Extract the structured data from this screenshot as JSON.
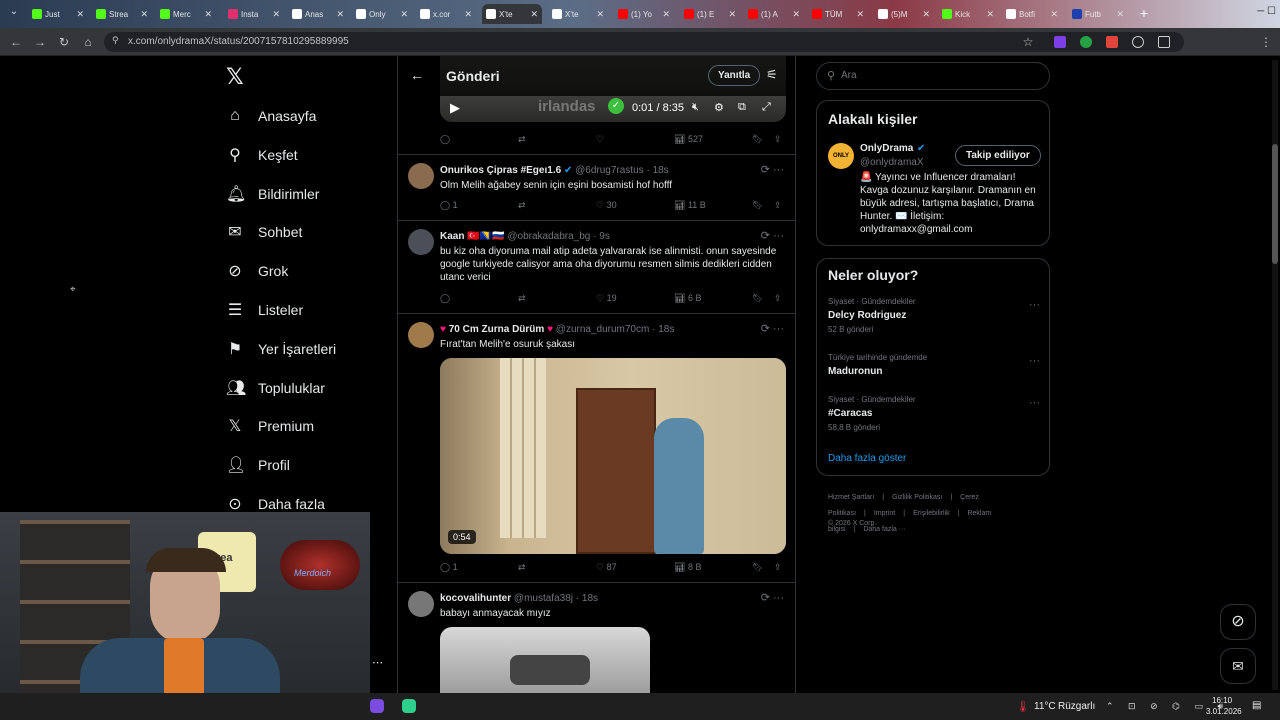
{
  "browser": {
    "tabs": [
      {
        "label": "Just",
        "icon": "kick-icon",
        "color": "#53fc18",
        "active": false
      },
      {
        "label": "Strea",
        "icon": "kick-icon",
        "color": "#53fc18",
        "active": false
      },
      {
        "label": "Merc",
        "icon": "kick-icon",
        "color": "#53fc18",
        "active": false
      },
      {
        "label": "Insta",
        "icon": "instagram-icon",
        "color": "#e1306c",
        "active": false
      },
      {
        "label": "Anas",
        "icon": "x-icon",
        "color": "#ffffff",
        "active": false
      },
      {
        "label": "Only",
        "icon": "x-icon",
        "color": "#ffffff",
        "active": false
      },
      {
        "label": "x.cor",
        "icon": "x-icon",
        "color": "#ffffff",
        "active": false
      },
      {
        "label": "X'te",
        "icon": "x-icon",
        "color": "#ffffff",
        "active": true
      },
      {
        "label": "X'te",
        "icon": "x-icon",
        "color": "#ffffff",
        "active": false
      },
      {
        "label": "(1) Yo",
        "icon": "youtube-icon",
        "color": "#ff0000",
        "active": false
      },
      {
        "label": "(1) E",
        "icon": "youtube-icon",
        "color": "#ff0000",
        "active": false
      },
      {
        "label": "(1) A",
        "icon": "youtube-icon",
        "color": "#ff0000",
        "active": false
      },
      {
        "label": "TÜM",
        "icon": "youtube-icon",
        "color": "#ff0000",
        "active": false
      },
      {
        "label": "(5)M",
        "icon": "tiktok-icon",
        "color": "#ffffff",
        "active": false
      },
      {
        "label": "Kick",
        "icon": "kick-icon",
        "color": "#53fc18",
        "active": false
      },
      {
        "label": "Botfi",
        "icon": "bot-icon",
        "color": "#ffffff",
        "active": false
      },
      {
        "label": "Futb",
        "icon": "football-icon",
        "color": "#1e40af",
        "active": false
      }
    ],
    "url": "x.com/onlydramaX/status/2007157810295889995"
  },
  "sidebar": {
    "items": [
      {
        "label": "Anasayfa",
        "icon": "home-icon"
      },
      {
        "label": "Keşfet",
        "icon": "search-icon"
      },
      {
        "label": "Bildirimler",
        "icon": "bell-icon"
      },
      {
        "label": "Sohbet",
        "icon": "mail-icon"
      },
      {
        "label": "Grok",
        "icon": "grok-icon"
      },
      {
        "label": "Listeler",
        "icon": "list-icon"
      },
      {
        "label": "Yer İşaretleri",
        "icon": "bookmark-icon"
      },
      {
        "label": "Topluluklar",
        "icon": "communities-icon"
      },
      {
        "label": "Premium",
        "icon": "x-icon"
      },
      {
        "label": "Profil",
        "icon": "profile-icon"
      },
      {
        "label": "Daha fazla",
        "icon": "more-icon"
      }
    ]
  },
  "header": {
    "title": "Gönderi",
    "reply_button": "Yanıtla"
  },
  "video_top": {
    "time": "0:01 / 8:35",
    "overlay_text": "irlandas"
  },
  "top_actions": {
    "views": "527"
  },
  "tweets": [
    {
      "name": "Onurikos Çipras #Egeı1.6",
      "handle": "@6drug7rastus",
      "time": "18s",
      "text": "Olm Melih ağabey senin için eşini bosamisti hof hofff",
      "replies": "1",
      "likes": "30",
      "views": "11 B"
    },
    {
      "name": "Kaan",
      "flags": "🇹🇷🇧🇦🇷🇺",
      "handle": "@obrakadabra_bg",
      "time": "9s",
      "text": "bu kiz oha diyoruma mail atip adeta yalvararak ise alinmisti. onun sayesinde google turkiyede calisyor ama oha diyorumu resmen silmis dedikleri cidden utanc verici",
      "replies": "",
      "likes": "19",
      "views": "6 B"
    },
    {
      "name": "70 Cm Zurna Dürüm",
      "handle": "@zurna_durum70cm",
      "time": "18s",
      "text": "Fırat'tan Melih'e osuruk şakası",
      "video_duration": "0:54",
      "replies": "1",
      "likes": "87",
      "views": "8 B"
    },
    {
      "name": "kocovalihunter",
      "handle": "@mustafa38j",
      "time": "18s",
      "text": "babayı anmayacak mıyız"
    }
  ],
  "search": {
    "placeholder": "Ara"
  },
  "related": {
    "title": "Alakalı kişiler",
    "name": "OnlyDrama",
    "handle": "@onlydramaX",
    "follow_label": "Takip ediliyor",
    "bio": "🚨 Yayıncı ve Influencer dramaları! Kavga dozunuz karşılanır. Dramanın en büyük adresi, tartışma başlatıcı, Drama Hunter. ✉️ İletişim: onlydramaxx@gmail.com"
  },
  "trends": {
    "title": "Neler oluyor?",
    "items": [
      {
        "context": "Siyaset · Gündemdekiler",
        "name": "Delcy Rodriguez",
        "count": "52 B gönderi"
      },
      {
        "context": "Türkiye tarihinde gündemde",
        "name": "Maduronun",
        "count": ""
      },
      {
        "context": "Siyaset · Gündemdekiler",
        "name": "#Caracas",
        "count": "58,8 B gönderi"
      }
    ],
    "show_more": "Daha fazla göster"
  },
  "footer": {
    "links": [
      "Hizmet Şartları",
      "|",
      "Gizlilik Politikası",
      "|",
      "Çerez Politikası",
      "|",
      "Imprint",
      "|",
      "Erişilebilirlik",
      "|",
      "Reklam bilgisi",
      "|",
      "Daha fazla ···"
    ],
    "copyright": "© 2026 X Corp."
  },
  "webcam": {
    "sign": "Merdoich",
    "shirt": "avea"
  },
  "taskbar": {
    "weather": "11°C",
    "weather_label": "Rüzgarlı",
    "time": "16:10",
    "date": "3.01.2026"
  },
  "colors": {
    "accent": "#1d9bf0",
    "like": "#f91880",
    "verified": "#1d9bf0"
  }
}
